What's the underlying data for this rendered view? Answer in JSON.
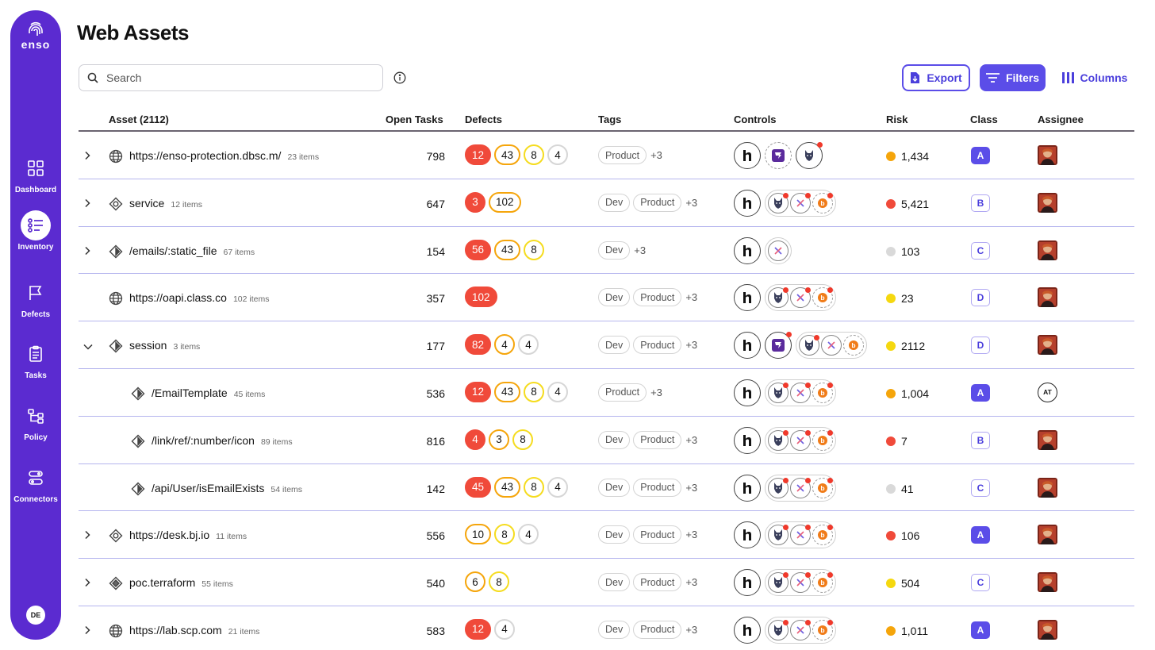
{
  "app": {
    "logo_text": "enso"
  },
  "sidebar": {
    "items": [
      {
        "label": "Dashboard",
        "icon": "grid-icon",
        "active": false
      },
      {
        "label": "Inventory",
        "icon": "list-icon",
        "active": true
      },
      {
        "label": "Defects",
        "icon": "flag-icon",
        "active": false
      },
      {
        "label": "Tasks",
        "icon": "clipboard-icon",
        "active": false
      },
      {
        "label": "Policy",
        "icon": "hierarchy-icon",
        "active": false
      },
      {
        "label": "Connectors",
        "icon": "connector-icon",
        "active": false
      }
    ],
    "user_initials": "DE"
  },
  "page": {
    "title": "Web Assets"
  },
  "search": {
    "placeholder": "Search",
    "value": ""
  },
  "toolbar": {
    "export_label": "Export",
    "filters_label": "Filters",
    "columns_label": "Columns"
  },
  "columns": {
    "asset": "Asset (2112)",
    "open_tasks": "Open Tasks",
    "defects": "Defects",
    "tags": "Tags",
    "controls": "Controls",
    "risk": "Risk",
    "class": "Class",
    "assignee": "Assignee"
  },
  "colors": {
    "brand": "#5b2bd0",
    "accent": "#5b4de8",
    "critical": "#f04a3a",
    "high": "#f5a50b",
    "medium": "#f5dc1f",
    "low": "#d6d6d6",
    "risk_red": "#f04a3a",
    "risk_orange": "#f5a50b",
    "risk_yellow": "#f5d80f",
    "risk_gray": "#d9d9d9"
  },
  "rows": [
    {
      "level": 0,
      "chevron": "right",
      "icon": "globe-icon",
      "name": "https://enso-protection.dbsc.m/",
      "count": "23 items",
      "open_tasks": "798",
      "defects": [
        [
          "critical",
          "12"
        ],
        [
          "high",
          "43"
        ],
        [
          "medium",
          "8"
        ],
        [
          "low",
          "4"
        ]
      ],
      "tags": [
        "Product"
      ],
      "tags_more": "+3",
      "controls": "r1",
      "risk": "1,434",
      "risk_level": "orange",
      "class": "A",
      "class_solid": true,
      "assignee": "avatar"
    },
    {
      "level": 0,
      "chevron": "right",
      "icon": "service-icon",
      "name": "service",
      "count": "12 items",
      "open_tasks": "647",
      "defects": [
        [
          "critical",
          "3"
        ],
        [
          "high",
          "102"
        ]
      ],
      "tags": [
        "Dev",
        "Product"
      ],
      "tags_more": "+3",
      "controls": "std",
      "risk": "5,421",
      "risk_level": "red",
      "class": "B",
      "class_solid": false,
      "assignee": "avatar"
    },
    {
      "level": 0,
      "chevron": "right",
      "icon": "endpoint-icon",
      "name": "/emails/:static_file",
      "count": "67 items",
      "open_tasks": "154",
      "defects": [
        [
          "critical",
          "56"
        ],
        [
          "high",
          "43"
        ],
        [
          "medium",
          "8"
        ]
      ],
      "tags": [
        "Dev"
      ],
      "tags_more": "+3",
      "controls": "r3",
      "risk": "103",
      "risk_level": "gray",
      "class": "C",
      "class_solid": false,
      "assignee": "avatar"
    },
    {
      "level": 0,
      "chevron": "none",
      "icon": "globe-icon",
      "name": "https://oapi.class.co",
      "count": "102 items",
      "open_tasks": "357",
      "defects": [
        [
          "critical",
          "102"
        ]
      ],
      "tags": [
        "Dev",
        "Product"
      ],
      "tags_more": "+3",
      "controls": "std",
      "risk": "23",
      "risk_level": "yellow",
      "class": "D",
      "class_solid": false,
      "assignee": "avatar"
    },
    {
      "level": 0,
      "chevron": "down",
      "icon": "endpoint-icon",
      "name": "session",
      "count": "3 items",
      "open_tasks": "177",
      "defects": [
        [
          "critical",
          "82"
        ],
        [
          "high",
          "4"
        ],
        [
          "low",
          "4"
        ]
      ],
      "tags": [
        "Dev",
        "Product"
      ],
      "tags_more": "+3",
      "controls": "r5",
      "risk": "2112",
      "risk_level": "yellow",
      "class": "D",
      "class_solid": false,
      "assignee": "avatar"
    },
    {
      "level": 1,
      "chevron": "none",
      "icon": "endpoint-icon",
      "name": "/EmailTemplate",
      "count": "45 items",
      "open_tasks": "536",
      "defects": [
        [
          "critical",
          "12"
        ],
        [
          "high",
          "43"
        ],
        [
          "medium",
          "8"
        ],
        [
          "low",
          "4"
        ]
      ],
      "tags": [
        "Product"
      ],
      "tags_more": "+3",
      "controls": "std",
      "risk": "1,004",
      "risk_level": "orange",
      "class": "A",
      "class_solid": true,
      "assignee": "AT"
    },
    {
      "level": 1,
      "chevron": "none",
      "icon": "endpoint-icon",
      "name": "/link/ref/:number/icon",
      "count": "89 items",
      "open_tasks": "816",
      "defects": [
        [
          "critical",
          "4"
        ],
        [
          "high",
          "3"
        ],
        [
          "medium",
          "8"
        ]
      ],
      "tags": [
        "Dev",
        "Product"
      ],
      "tags_more": "+3",
      "controls": "std",
      "risk": "7",
      "risk_level": "red",
      "class": "B",
      "class_solid": false,
      "assignee": "avatar"
    },
    {
      "level": 1,
      "chevron": "none",
      "icon": "endpoint-icon",
      "name": "/api/User/isEmailExists",
      "count": "54 items",
      "open_tasks": "142",
      "defects": [
        [
          "critical",
          "45"
        ],
        [
          "high",
          "43"
        ],
        [
          "medium",
          "8"
        ],
        [
          "low",
          "4"
        ]
      ],
      "tags": [
        "Dev",
        "Product"
      ],
      "tags_more": "+3",
      "controls": "std",
      "risk": "41",
      "risk_level": "gray",
      "class": "C",
      "class_solid": false,
      "assignee": "avatar"
    },
    {
      "level": 0,
      "chevron": "right",
      "icon": "service-icon",
      "name": "https://desk.bj.io",
      "count": "11 items",
      "open_tasks": "556",
      "defects": [
        [
          "high",
          "10"
        ],
        [
          "medium",
          "8"
        ],
        [
          "low",
          "4"
        ]
      ],
      "tags": [
        "Dev",
        "Product"
      ],
      "tags_more": "+3",
      "controls": "std",
      "risk": "106",
      "risk_level": "red",
      "class": "A",
      "class_solid": true,
      "assignee": "avatar"
    },
    {
      "level": 0,
      "chevron": "right",
      "icon": "terraform-icon",
      "name": "poc.terraform",
      "count": "55 items",
      "open_tasks": "540",
      "defects": [
        [
          "high",
          "6"
        ],
        [
          "medium",
          "8"
        ]
      ],
      "tags": [
        "Dev",
        "Product"
      ],
      "tags_more": "+3",
      "controls": "std",
      "risk": "504",
      "risk_level": "yellow",
      "class": "C",
      "class_solid": false,
      "assignee": "avatar"
    },
    {
      "level": 0,
      "chevron": "right",
      "icon": "globe-icon",
      "name": "https://lab.scp.com",
      "count": "21 items",
      "open_tasks": "583",
      "defects": [
        [
          "critical",
          "12"
        ],
        [
          "low",
          "4"
        ]
      ],
      "tags": [
        "Dev",
        "Product"
      ],
      "tags_more": "+3",
      "controls": "std",
      "risk": "1,011",
      "risk_level": "orange",
      "class": "A",
      "class_solid": true,
      "assignee": "avatar"
    }
  ]
}
